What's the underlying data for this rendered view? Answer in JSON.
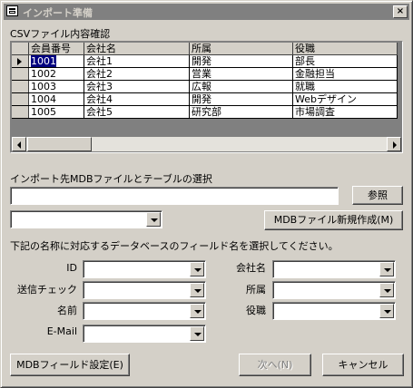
{
  "window": {
    "title": "インポート準備",
    "close_label": "×"
  },
  "csv_section": {
    "label": "CSVファイル内容確認",
    "columns": [
      "会員番号",
      "会社名",
      "所属",
      "役職"
    ],
    "rows": [
      [
        "1001",
        "会社1",
        "開発",
        "部長"
      ],
      [
        "1002",
        "会社2",
        "営業",
        "金融担当"
      ],
      [
        "1003",
        "会社3",
        "広報",
        "就職"
      ],
      [
        "1004",
        "会社4",
        "開発",
        "Webデザイン"
      ],
      [
        "1005",
        "会社5",
        "研究部",
        "市場調査"
      ]
    ],
    "selected_row": 0
  },
  "mdb_section": {
    "label": "インポート先MDBファイルとテーブルの選択",
    "file_value": "",
    "browse_label": "参照",
    "table_value": "",
    "new_mdb_label": "MDBファイル新規作成(M)"
  },
  "mapping_section": {
    "instruction": "下記の名称に対応するデータベースのフィールド名を選択してください。",
    "fields": {
      "id": "ID",
      "send_check": "送信チェック",
      "name": "名前",
      "email": "E-Mail",
      "company": "会社名",
      "affiliation": "所属",
      "position": "役職"
    }
  },
  "footer": {
    "mdb_field_settings_label": "MDBフィールド設定(E)",
    "next_label": "次へ(N)",
    "cancel_label": "キャンセル"
  }
}
